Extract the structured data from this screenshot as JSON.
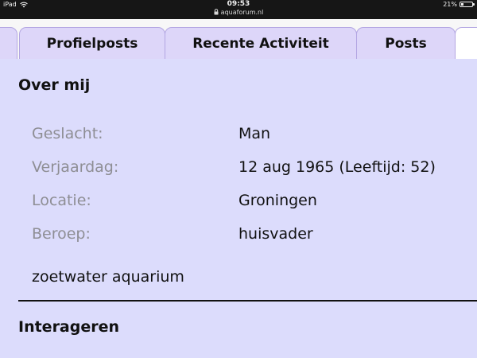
{
  "status_bar": {
    "device": "iPad",
    "time": "09:53",
    "url": "aquaforum.nl",
    "battery": "21%",
    "battery_level": 0.21
  },
  "tabs": [
    {
      "label": "Profielposts"
    },
    {
      "label": "Recente Activiteit"
    },
    {
      "label": "Posts"
    }
  ],
  "about": {
    "title": "Over mij",
    "fields": [
      {
        "label": "Geslacht:",
        "value": "Man"
      },
      {
        "label": "Verjaardag:",
        "value": "12 aug 1965 (Leeftijd: 52)"
      },
      {
        "label": "Locatie:",
        "value": "Groningen"
      },
      {
        "label": "Beroep:",
        "value": "huisvader"
      }
    ],
    "text": "zoetwater aquarium"
  },
  "interact": {
    "title": "Interageren"
  }
}
